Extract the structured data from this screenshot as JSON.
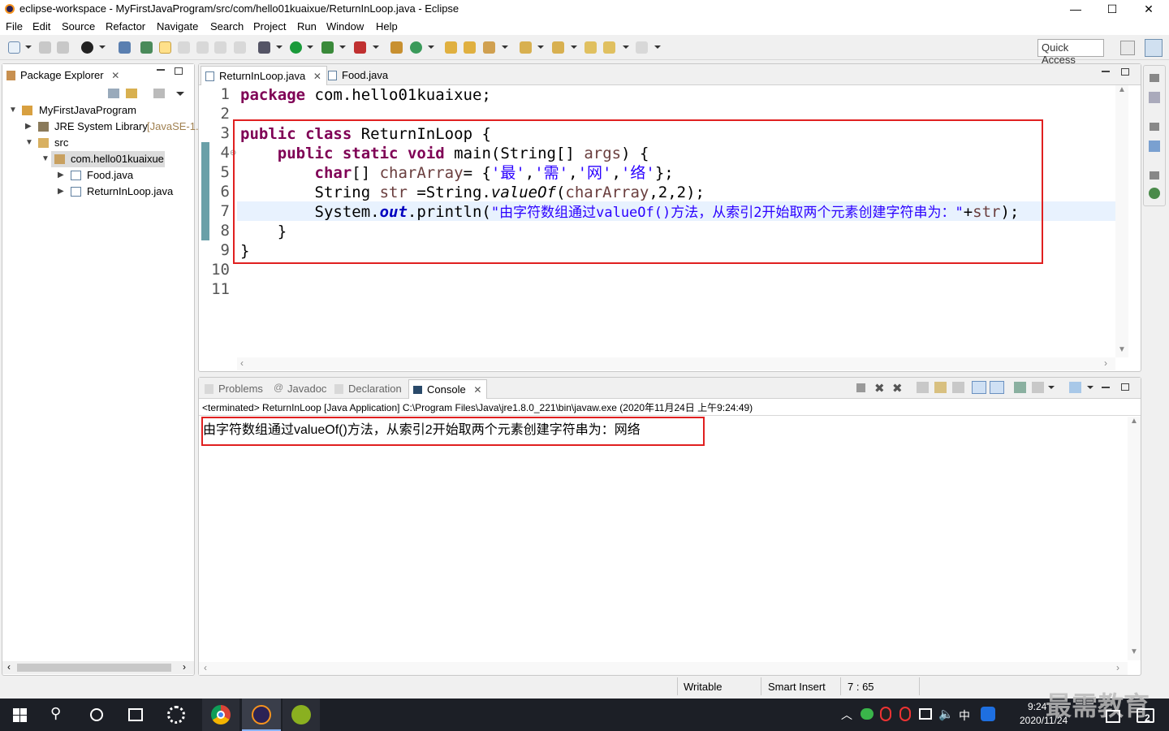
{
  "window": {
    "title": "eclipse-workspace - MyFirstJavaProgram/src/com/hello01kuaixue/ReturnInLoop.java - Eclipse",
    "min": "—",
    "max": "☐",
    "close": "✕"
  },
  "menu": [
    "File",
    "Edit",
    "Source",
    "Refactor",
    "Navigate",
    "Search",
    "Project",
    "Run",
    "Window",
    "Help"
  ],
  "toolbar": {
    "quick_access": "Quick Access"
  },
  "package_explorer": {
    "title": "Package Explorer",
    "close": "✕",
    "tree": [
      {
        "label": "MyFirstJavaProgram",
        "extra": ""
      },
      {
        "label": "JRE System Library",
        "extra": "[JavaSE-1."
      },
      {
        "label": "src",
        "extra": ""
      },
      {
        "label": "com.hello01kuaixue",
        "extra": ""
      },
      {
        "label": "Food.java",
        "extra": ""
      },
      {
        "label": "ReturnInLoop.java",
        "extra": ""
      }
    ]
  },
  "editor": {
    "tabs": [
      {
        "label": "ReturnInLoop.java",
        "close": "✕"
      },
      {
        "label": "Food.java",
        "close": ""
      }
    ],
    "line_numbers": [
      "1",
      "2",
      "3",
      "4",
      "5",
      "6",
      "7",
      "8",
      "9",
      "10",
      "11"
    ],
    "code": {
      "l1_kw": "package",
      "l1_rest": " com.hello01kuaixue;",
      "l3_kw1": "public",
      "l3_kw2": "class",
      "l3_rest": " ReturnInLoop {",
      "l4_indent": "    ",
      "l4_kw1": "public",
      "l4_kw2": "static",
      "l4_kw3": "void",
      "l4_m": " main(String[] ",
      "l4_var": "args",
      "l4_end": ") {",
      "l5_indent": "        ",
      "l5_kw": "char",
      "l5_a": "[] ",
      "l5_var": "charArray",
      "l5_b": "= {",
      "l5_c1": "'最'",
      "l5_c2": "'需'",
      "l5_c3": "'网'",
      "l5_c4": "'络'",
      "l5_comma": ",",
      "l5_end": "};",
      "l6_indent": "        ",
      "l6_a": "String ",
      "l6_var": "str",
      "l6_b": " =String.",
      "l6_m": "valueOf",
      "l6_c": "(",
      "l6_var2": "charArray",
      "l6_d": ",2,2);",
      "l7_indent": "        ",
      "l7_a": "System.",
      "l7_fld": "out",
      "l7_b": ".println(",
      "l7_str": "\"由字符数组通过valueOf()方法，从索引2开始取两个元素创建字符串为：\"",
      "l7_c": "+",
      "l7_var": "str",
      "l7_d": ");",
      "l8": "    }",
      "l9": "}"
    }
  },
  "bottom_panel": {
    "tabs": [
      {
        "label": "Problems"
      },
      {
        "label": "Javadoc"
      },
      {
        "label": "Declaration"
      },
      {
        "label": "Console",
        "close": "✕"
      }
    ],
    "terminated": "<terminated> ReturnInLoop [Java Application] C:\\Program Files\\Java\\jre1.8.0_221\\bin\\javaw.exe (2020年11月24日 上午9:24:49)",
    "output": "由字符数组通过valueOf()方法，从索引2开始取两个元素创建字符串为：网络"
  },
  "status": {
    "writable": "Writable",
    "insert": "Smart Insert",
    "position": "7 : 65"
  },
  "taskbar": {
    "time": "9:24",
    "date": "2020/11/24",
    "ime": "中",
    "watermark": "最需教育",
    "notif": "2"
  }
}
